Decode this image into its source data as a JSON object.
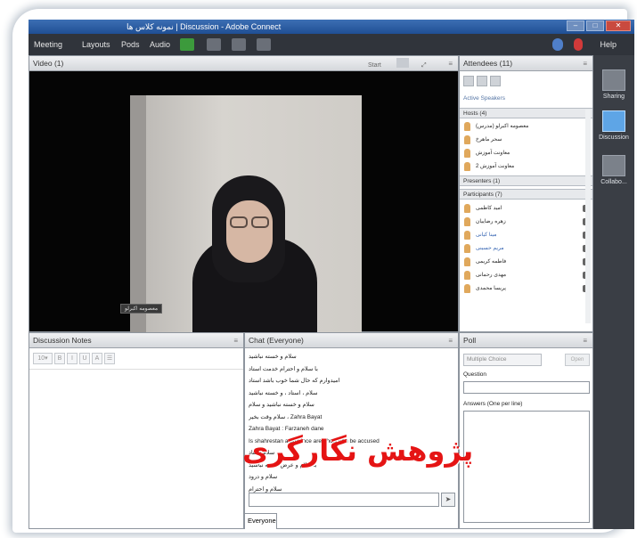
{
  "window": {
    "title": "نمونه کلاس ها | Discussion - Adobe Connect"
  },
  "menu": {
    "items": [
      "Meeting",
      "Layouts",
      "Pods",
      "Audio"
    ],
    "help": "Help"
  },
  "video_pod": {
    "title": "Video (1)",
    "start_label": "Start",
    "participant_label": "معصومه اکبرلو"
  },
  "notes_pod": {
    "title": "Discussion Notes"
  },
  "chat_pod": {
    "title": "Chat (Everyone)",
    "messages": [
      "سلام و خسته نباشید",
      "با سلام و احترام خدمت استاد",
      "امیدوارم که حال شما خوب باشد استاد",
      "سلام ، استاد ، و خسته نباشید",
      "سلام و خسته نباشید و سلام",
      "سلام وقت بخیر ، Zahra Bayat",
      "Zahra Bayat : Farzaneh dane",
      "Is shahrestan a province area how can be accused",
      "سلام استاد",
      "با سلام و عرض خسته نباشید",
      "سلام و درود",
      "سلام و احترام"
    ],
    "tab_label": "Everyone"
  },
  "attendees_pod": {
    "title": "Attendees (11)",
    "active_speakers": "Active Speakers",
    "hosts_label": "Hosts (4)",
    "hosts": [
      "معصومه اکبرلو (مدرس)",
      "سحر ماهرخ",
      "معاونت آموزش",
      "معاونت آموزش 2"
    ],
    "presenters_label": "Presenters (1)",
    "participants_label": "Participants (7)",
    "participants": [
      "امید کاظمی",
      "زهره رضاییان",
      "مینا کیانی",
      "مریم حسینی",
      "فاطمه کریمی",
      "مهدی رحمانی",
      "پریسا محمدی"
    ]
  },
  "poll_pod": {
    "title": "Poll",
    "select_placeholder": "Multiple Choice",
    "open_button": "Open",
    "question_label": "Question",
    "answers_label": "Answers (One per line)"
  },
  "sidebar": {
    "layouts": [
      "Sharing",
      "Discussion",
      "Collabo..."
    ],
    "active": "Discussion"
  },
  "watermark": "پژوهش نگارگری"
}
